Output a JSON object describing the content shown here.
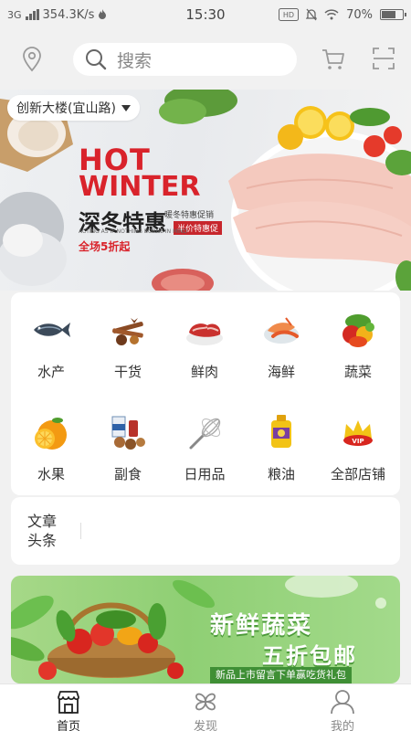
{
  "status_bar": {
    "network": "3G",
    "speed": "354.3K/s",
    "time": "15:30",
    "battery": "70%"
  },
  "header": {
    "search_placeholder": "搜索",
    "location_icon": "location-pin-icon",
    "cart_icon": "cart-icon",
    "scan_icon": "scan-icon"
  },
  "banner": {
    "address": "创新大楼(宜山路)",
    "hot": "HOT",
    "winter": "WINTER",
    "title_cn": "深冬特惠",
    "tag_top": "暖冬特惠促销",
    "tag_bottom": "半价特惠促",
    "acting": "ACTING AS IF NOTHING BORNE IN MIND",
    "discount": "全场5折起"
  },
  "categories": [
    {
      "label": "水产",
      "icon": "fish-icon"
    },
    {
      "label": "干货",
      "icon": "dried-goods-icon"
    },
    {
      "label": "鲜肉",
      "icon": "meat-icon"
    },
    {
      "label": "海鲜",
      "icon": "seafood-icon"
    },
    {
      "label": "蔬菜",
      "icon": "vegetables-icon"
    },
    {
      "label": "水果",
      "icon": "orange-icon"
    },
    {
      "label": "副食",
      "icon": "groceries-icon"
    },
    {
      "label": "日用品",
      "icon": "whisk-icon"
    },
    {
      "label": "粮油",
      "icon": "oil-icon"
    },
    {
      "label": "全部店铺",
      "icon": "vip-crown-icon"
    }
  ],
  "news": {
    "title": "文章头条"
  },
  "promo": {
    "line1": "新鲜蔬菜",
    "line2": "五折包邮",
    "line3": "新品上市留言下单赢吃货礼包"
  },
  "tabbar": {
    "tabs": [
      {
        "label": "首页",
        "icon": "store-icon",
        "active": true
      },
      {
        "label": "发现",
        "icon": "discover-icon",
        "active": false
      },
      {
        "label": "我的",
        "icon": "user-icon",
        "active": false
      }
    ]
  },
  "colors": {
    "accent_red": "#d9232b",
    "background": "#f1f1f1",
    "promo_green": "#8fcf74"
  }
}
